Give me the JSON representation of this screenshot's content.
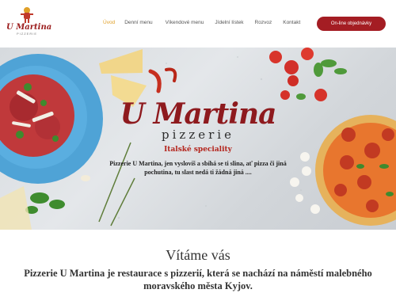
{
  "logo": {
    "name": "U Martina",
    "sub": "PIZZERIE"
  },
  "nav": {
    "items": [
      {
        "label": "Úvod",
        "active": true
      },
      {
        "label": "Denní menu"
      },
      {
        "label": "Víkendové menu"
      },
      {
        "label": "Jídelní lístek"
      },
      {
        "label": "Rozvoz"
      },
      {
        "label": "Kontakt"
      }
    ],
    "order_label": "On-line objednávky"
  },
  "hero": {
    "title": "U Martina",
    "subtitle": "pizzerie",
    "tagline": "Italské speciality",
    "description": "Pizzerie U Martina, jen vyslovíš a sbíhá se ti slina, ať pizza či jiná pochutina, tu slast nedá ti žádná jiná ...."
  },
  "welcome": {
    "title": "Vítáme vás",
    "text": "Pizzerie U Martina je restaurace s pizzerií, která se nachází na náměstí malebného moravského města Kyjov."
  },
  "colors": {
    "brand_red": "#a41d23",
    "title_red": "#8e1a1e",
    "active_nav": "#e0a028",
    "plate_blue": "#4fa3d6"
  }
}
